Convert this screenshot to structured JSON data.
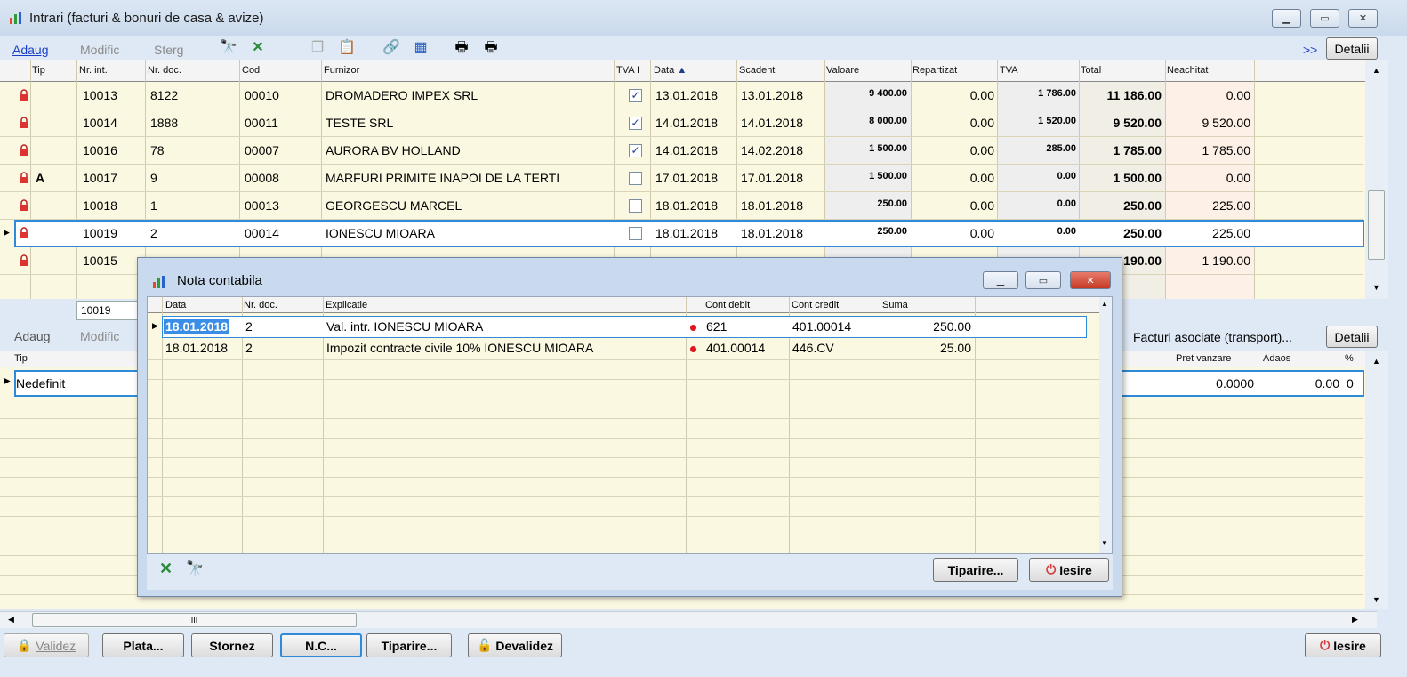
{
  "window": {
    "title": "Intrari (facturi & bonuri de casa & avize)"
  },
  "toolbar": {
    "add": "Adaug",
    "modify": "Modific",
    "delete": "Sterg",
    "more": ">>",
    "details": "Detalii"
  },
  "columns": [
    "Tip",
    "Nr. int.",
    "Nr. doc.",
    "Cod",
    "Furnizor",
    "TVA I",
    "Data",
    "Scadent",
    "Valoare",
    "Repartizat",
    "TVA",
    "Total",
    "Neachitat"
  ],
  "rows": [
    {
      "tip": "",
      "nr_int": "10013",
      "nr_doc": "8122",
      "cod": "00010",
      "furnizor": "DROMADERO IMPEX SRL",
      "tva_i": true,
      "data": "13.01.2018",
      "scadent": "13.01.2018",
      "valoare": "9 400.00",
      "repartizat": "0.00",
      "tva": "1 786.00",
      "total": "11 186.00",
      "neachitat": "0.00"
    },
    {
      "tip": "",
      "nr_int": "10014",
      "nr_doc": "1888",
      "cod": "00011",
      "furnizor": "TESTE SRL",
      "tva_i": true,
      "data": "14.01.2018",
      "scadent": "14.01.2018",
      "valoare": "8 000.00",
      "repartizat": "0.00",
      "tva": "1 520.00",
      "total": "9 520.00",
      "neachitat": "9 520.00"
    },
    {
      "tip": "",
      "nr_int": "10016",
      "nr_doc": "78",
      "cod": "00007",
      "furnizor": "AURORA BV HOLLAND",
      "tva_i": true,
      "data": "14.01.2018",
      "scadent": "14.02.2018",
      "valoare": "1 500.00",
      "repartizat": "0.00",
      "tva": "285.00",
      "total": "1 785.00",
      "neachitat": "1 785.00"
    },
    {
      "tip": "A",
      "nr_int": "10017",
      "nr_doc": "9",
      "cod": "00008",
      "furnizor": "MARFURI PRIMITE INAPOI DE LA TERTI",
      "tva_i": false,
      "data": "17.01.2018",
      "scadent": "17.01.2018",
      "valoare": "1 500.00",
      "repartizat": "0.00",
      "tva": "0.00",
      "total": "1 500.00",
      "neachitat": "0.00"
    },
    {
      "tip": "",
      "nr_int": "10018",
      "nr_doc": "1",
      "cod": "00013",
      "furnizor": "GEORGESCU MARCEL",
      "tva_i": false,
      "data": "18.01.2018",
      "scadent": "18.01.2018",
      "valoare": "250.00",
      "repartizat": "0.00",
      "tva": "0.00",
      "total": "250.00",
      "neachitat": "225.00"
    },
    {
      "tip": "",
      "nr_int": "10019",
      "nr_doc": "2",
      "cod": "00014",
      "furnizor": "IONESCU MIOARA",
      "tva_i": false,
      "data": "18.01.2018",
      "scadent": "18.01.2018",
      "valoare": "250.00",
      "repartizat": "0.00",
      "tva": "0.00",
      "total": "250.00",
      "neachitat": "225.00"
    },
    {
      "tip": "",
      "nr_int": "10015",
      "nr_doc": "",
      "cod": "",
      "furnizor": "",
      "tva_i": false,
      "data": "",
      "scadent": "",
      "valoare": "",
      "repartizat": "",
      "tva": "",
      "total": "190.00",
      "neachitat": "1 190.00"
    }
  ],
  "lower": {
    "current_nr": "10019",
    "add": "Adaug",
    "modify": "Modific",
    "associated": "Facturi asociate (transport)...",
    "details": "Detalii",
    "columns": [
      "Tip",
      "Pret vanzare",
      "Adaos",
      "%"
    ],
    "row": {
      "tip": "Nedefinit",
      "pret": "0.0000",
      "adaos": "0.00",
      "pct": "0"
    }
  },
  "bottom": {
    "validate": "Validez",
    "plata": "Plata...",
    "stornez": "Stornez",
    "nc": "N.C...",
    "tiparire": "Tiparire...",
    "devalidez": "Devalidez",
    "iesire": "Iesire"
  },
  "dialog": {
    "title": "Nota contabila",
    "columns": [
      "Data",
      "Nr. doc.",
      "Explicatie",
      "Cont debit",
      "Cont credit",
      "Suma"
    ],
    "rows": [
      {
        "data": "18.01.2018",
        "nr_doc": "2",
        "explicatie": "Val. intr. IONESCU MIOARA",
        "debit": "621",
        "credit": "401.00014",
        "suma": "250.00"
      },
      {
        "data": "18.01.2018",
        "nr_doc": "2",
        "explicatie": "Impozit contracte civile 10% IONESCU MIOARA",
        "debit": "401.00014",
        "credit": "446.CV",
        "suma": "25.00"
      }
    ],
    "print": "Tiparire...",
    "exit": "Iesire"
  },
  "scrollbar_glyph": "III",
  "colors": {
    "accent": "#2f8ad9",
    "grid_bg": "#fbf8e1",
    "link": "#1a3ec9",
    "exit_icon": "#d83a3a"
  }
}
